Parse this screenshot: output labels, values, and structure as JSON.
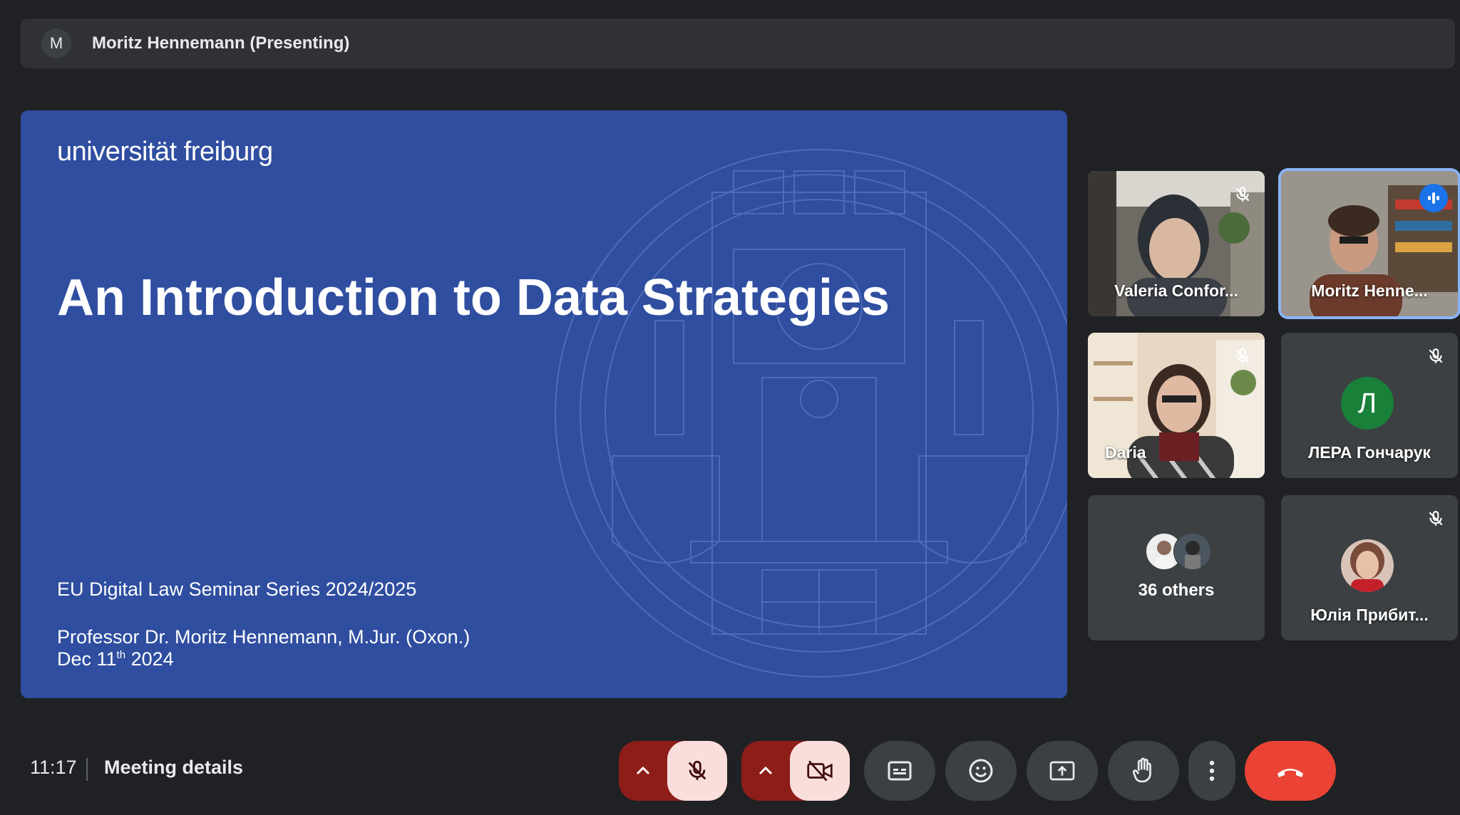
{
  "presenter": {
    "avatar_letter": "M",
    "label": "Moritz Hennemann (Presenting)"
  },
  "slide": {
    "logo_text": "universität freiburg",
    "title": "An Introduction to Data Strategies",
    "series": "EU Digital Law Seminar Series 2024/2025",
    "author": "Professor Dr. Moritz Hennemann, M.Jur. (Oxon.)",
    "date_prefix": "Dec 11",
    "date_suffix": "th",
    "date_year": " 2024"
  },
  "participants": [
    {
      "name": "Valeria Confor...",
      "muted": true
    },
    {
      "name": "Moritz Henne...",
      "speaking": true
    },
    {
      "name": "Daria",
      "muted": true
    },
    {
      "name": "ЛЕРА Гончарук",
      "avatar_letter": "Л",
      "muted": true
    },
    {
      "name": "36 others"
    },
    {
      "name": "Юлія Прибит...",
      "muted": true
    }
  ],
  "bottom_bar": {
    "time": "11:17",
    "meeting_details": "Meeting details"
  },
  "colors": {
    "background": "#202124",
    "slide_blue": "#2f4ea0",
    "end_call": "#ea4335",
    "muted_bg": "#8c1d18",
    "muted_fg": "#f9dedc",
    "active_border": "#8ab4f8"
  }
}
